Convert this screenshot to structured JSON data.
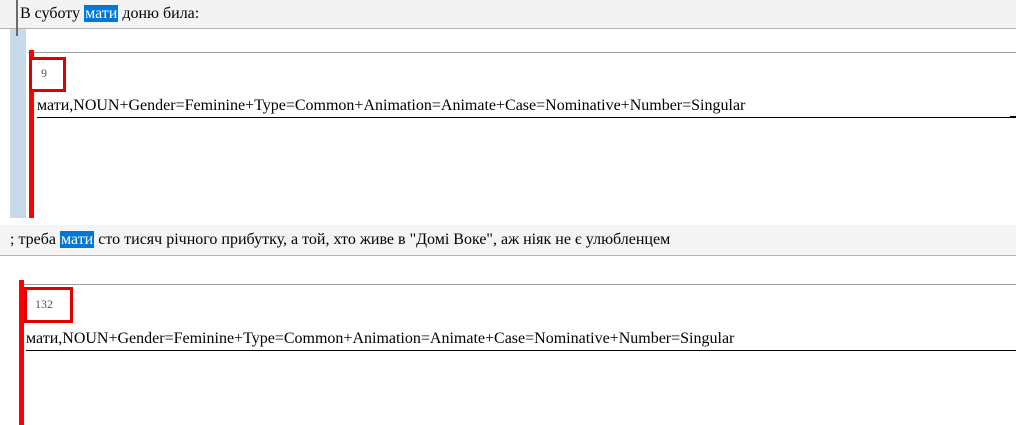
{
  "occurrences": [
    {
      "sentence_before": "В суботу ",
      "highlight": "мати",
      "sentence_after": " доню била:",
      "token_id": "9",
      "morph": "мати,NOUN+Gender=Feminine+Type=Common+Animation=Animate+Case=Nominative+Number=Singular"
    },
    {
      "sentence_before": "; треба ",
      "highlight": "мати",
      "sentence_after": " сто тисяч річного прибутку, а той, хто живе в \"Домі Воке\", аж ніяк не є улюбленцем",
      "token_id": "132",
      "morph": "мати,NOUN+Gender=Feminine+Type=Common+Animation=Animate+Case=Nominative+Number=Singular"
    }
  ],
  "colors": {
    "highlight_bg": "#0078d7",
    "marker_red": "#ff0000",
    "strip_blue": "#c9d9ec"
  }
}
